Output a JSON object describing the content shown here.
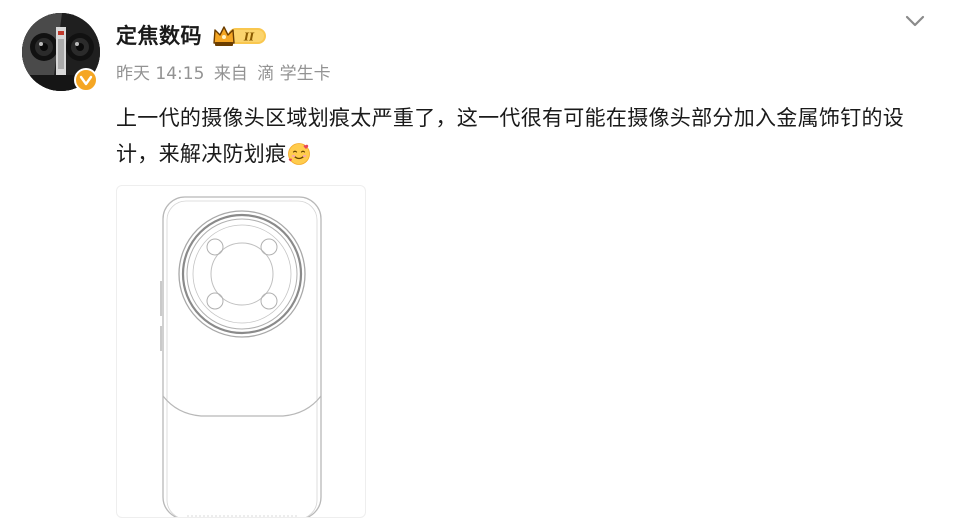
{
  "post": {
    "author": {
      "name": "定焦数码",
      "member_badge_text": "II",
      "verified": true
    },
    "meta": {
      "time": "昨天 14:15",
      "source_prefix": "来自",
      "source_icon": "didi-icon",
      "source_name": "滴 学生卡"
    },
    "text": "上一代的摄像头区域划痕太严重了，这一代很有可能在摄像头部分加入金属饰钉的设计，来解决防划痕",
    "emoji": "smiling-face-with-hearts-emoji",
    "image": {
      "description_icon": "phone-design-sketch"
    }
  },
  "colors": {
    "text": "#1a1a1a",
    "meta": "#939393",
    "badge_gold": "#f5a623",
    "collapse_icon": "#8a8a8a"
  }
}
